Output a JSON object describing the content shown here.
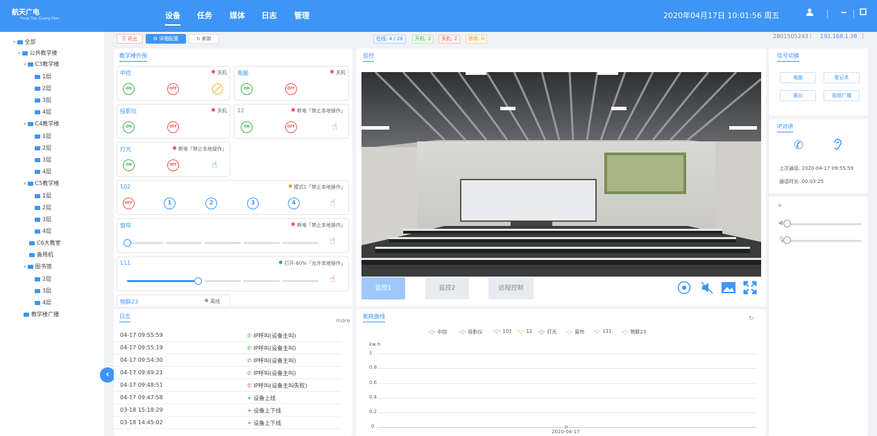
{
  "header": {
    "logo_title": "航天广电",
    "logo_sub": "Hang Tian Guang Dian",
    "nav": [
      "设备",
      "任务",
      "媒体",
      "日志",
      "管理"
    ],
    "datetime": "2020年04月17日 10:01:56  周五"
  },
  "tree": [
    {
      "label": "全部",
      "icon": "folder"
    },
    {
      "label": "公共教学楼",
      "icon": "folder"
    },
    {
      "label": "C3教学楼",
      "icon": "folder"
    },
    {
      "label": "1层",
      "icon": "folder"
    },
    {
      "label": "2层",
      "icon": "folder"
    },
    {
      "label": "3层",
      "icon": "folder"
    },
    {
      "label": "4层",
      "icon": "folder"
    },
    {
      "label": "C4教学楼",
      "icon": "folder"
    },
    {
      "label": "1层",
      "icon": "folder"
    },
    {
      "label": "2层",
      "icon": "folder"
    },
    {
      "label": "3层",
      "icon": "folder"
    },
    {
      "label": "4层",
      "icon": "folder"
    },
    {
      "label": "C5教学楼",
      "icon": "folder"
    },
    {
      "label": "1层",
      "icon": "folder"
    },
    {
      "label": "2层",
      "icon": "folder"
    },
    {
      "label": "3层",
      "icon": "folder"
    },
    {
      "label": "4层",
      "icon": "folder"
    },
    {
      "label": "C6大教室",
      "icon": "folder"
    },
    {
      "label": "备用机",
      "icon": "folder"
    },
    {
      "label": "图书馆",
      "icon": "folder"
    },
    {
      "label": "2层",
      "icon": "folder"
    },
    {
      "label": "3层",
      "icon": "folder"
    },
    {
      "label": "4层",
      "icon": "folder"
    },
    {
      "label": "教学楼广播",
      "icon": "folder"
    }
  ],
  "toolbar": {
    "exit": "退出",
    "detail": "详细配置",
    "refresh": "刷新",
    "online": "在线: 4 / 28",
    "on": "开机: 2",
    "off": "关机: 2",
    "disabled": "禁用: 0",
    "device_id": "2801505243",
    "ip": "192.168.1.38"
  },
  "exterior": {
    "title": "教学楼外围",
    "cards": [
      {
        "name": "中控",
        "status": "关机"
      },
      {
        "name": "电脑",
        "status": "关机"
      },
      {
        "name": "投影仪",
        "status": "关机"
      },
      {
        "name": "12",
        "status": "断电「禁止本地操作」"
      },
      {
        "name": "灯光",
        "status": "断电「禁止本地操作」"
      },
      {
        "name": "102",
        "status": "模式1「禁止本地操作」"
      },
      {
        "name": "窗帘",
        "status": "断电「禁止本地操作」"
      },
      {
        "name": "111",
        "status": "打开-60%「允许本地操作」"
      },
      {
        "name": "物联23",
        "status": "离线"
      }
    ],
    "btn_on": "ON",
    "btn_off": "OFF",
    "modes": [
      "1",
      "2",
      "3",
      "4"
    ],
    "curtain_level": 0,
    "slider_111_level": 0.6,
    "colors": {
      "off": "#e55555",
      "mode": "#f0a030",
      "on": "#3cb34a",
      "offline": "#999999"
    }
  },
  "monitor": {
    "title": "监控",
    "tabs": [
      "监控1",
      "监控2",
      "远程控制"
    ]
  },
  "log": {
    "title": "日志",
    "more": "more",
    "rows": [
      {
        "time": "04-17 09:55:59",
        "msg": "IP呼叫(设备主叫)"
      },
      {
        "time": "04-17 09:55:19",
        "msg": "IP呼叫(设备主叫)"
      },
      {
        "time": "04-17 09:54:30",
        "msg": "IP呼叫(设备主叫)"
      },
      {
        "time": "04-17 09:49:21",
        "msg": "IP呼叫(设备主叫)"
      },
      {
        "time": "04-17 09:48:51",
        "msg": "IP呼叫(设备主叫失败)"
      },
      {
        "time": "04-17 09:47:58",
        "msg": "设备上线"
      },
      {
        "time": "03-18 15:18:29",
        "msg": "设备上下线"
      },
      {
        "time": "03-18 14:45:02",
        "msg": "设备上下线"
      }
    ]
  },
  "energy": {
    "title": "能耗曲线"
  },
  "chart_data": {
    "type": "line",
    "ylabel": "kw·h",
    "ylim": [
      0,
      1
    ],
    "yticks": [
      "1",
      "0.8",
      "0.6",
      "0.4",
      "0.2",
      "0"
    ],
    "categories": [
      "2020-04-17"
    ],
    "series": [
      {
        "name": "中控",
        "values": [
          0
        ],
        "color": "#3cb34a"
      },
      {
        "name": "投影仪",
        "values": [
          0
        ],
        "color": "#3e95f5"
      },
      {
        "name": "102",
        "values": [
          0
        ],
        "color": "#e55555"
      },
      {
        "name": "12",
        "values": [
          0
        ],
        "color": "#f0a030"
      },
      {
        "name": "灯光",
        "values": [
          0
        ],
        "color": "#2c6fbb"
      },
      {
        "name": "窗帘",
        "values": [
          0
        ],
        "color": "#aaaaaa"
      },
      {
        "name": "111",
        "values": [
          0
        ],
        "color": "#e07070"
      },
      {
        "name": "物联23",
        "values": [
          0
        ],
        "color": "#7aa8d8"
      }
    ]
  },
  "signal": {
    "title": "信号切换",
    "buttons": [
      "电脑",
      "笔记本",
      "展台",
      "视频广播"
    ]
  },
  "intercom": {
    "title": "IP对讲",
    "last_call": "上次通话: 2020-04-17 09:55:59",
    "duration": "通话时长: 00:03:25"
  },
  "volume": {
    "speaker_level": 0,
    "mic_level": 0
  }
}
